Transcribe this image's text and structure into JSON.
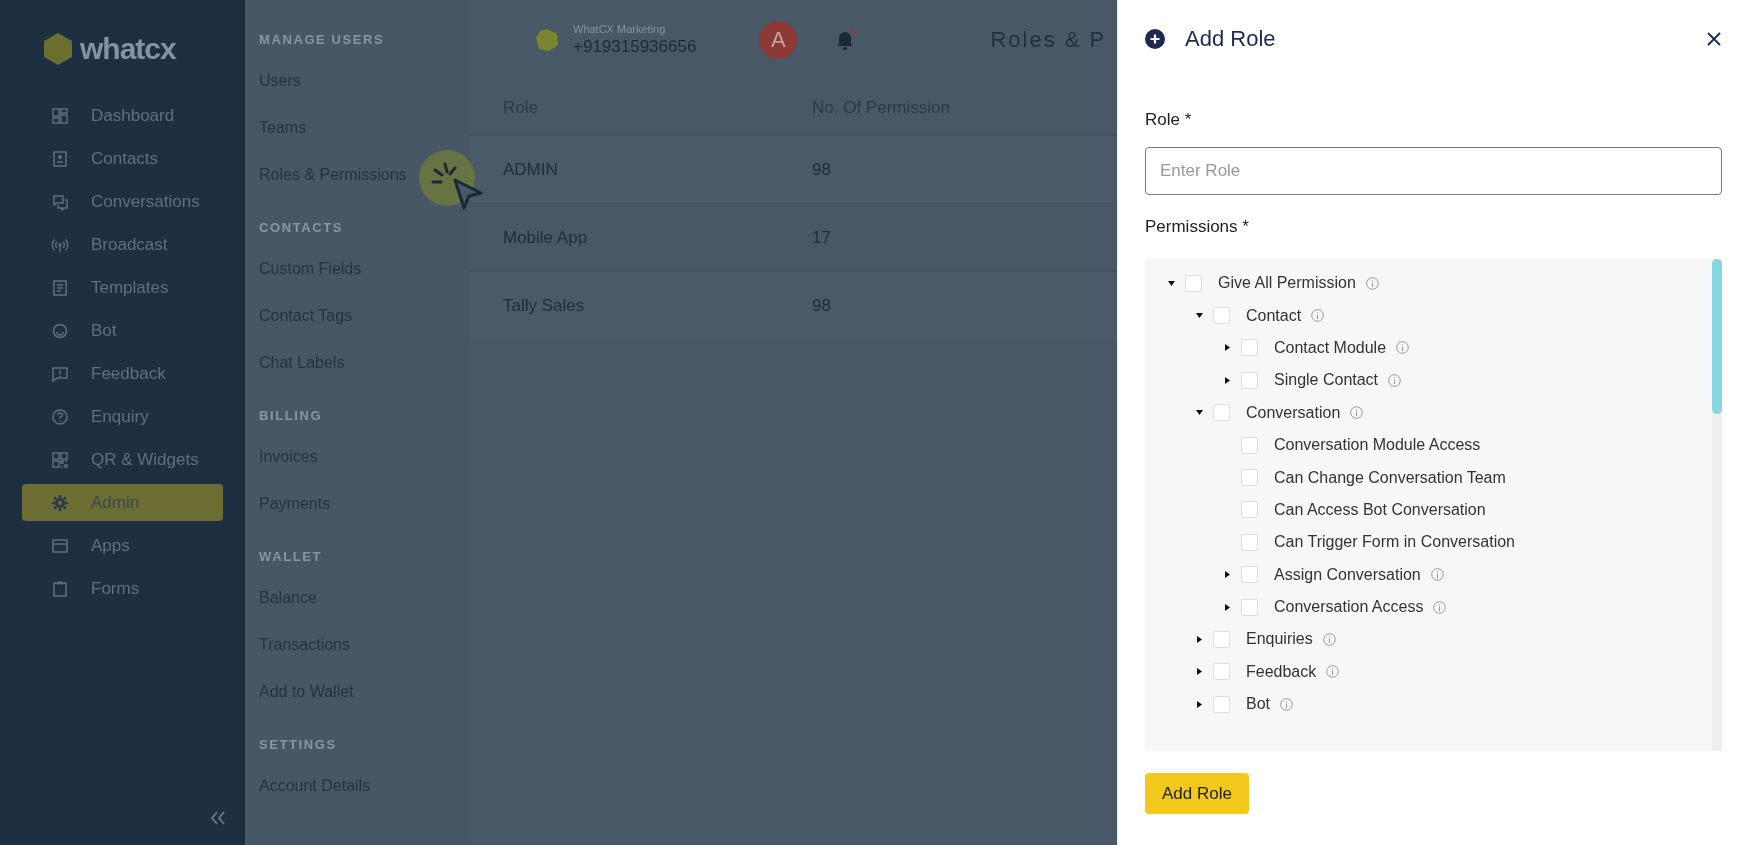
{
  "sidebar": {
    "logo": "whatcx",
    "items": [
      {
        "label": "Dashboard",
        "selected": false
      },
      {
        "label": "Contacts",
        "selected": false
      },
      {
        "label": "Conversations",
        "selected": false
      },
      {
        "label": "Broadcast",
        "selected": false
      },
      {
        "label": "Templates",
        "selected": false
      },
      {
        "label": "Bot",
        "selected": false
      },
      {
        "label": "Feedback",
        "selected": false
      },
      {
        "label": "Enquiry",
        "selected": false
      },
      {
        "label": "QR & Widgets",
        "selected": false
      },
      {
        "label": "Admin",
        "selected": true
      },
      {
        "label": "Apps",
        "selected": false
      },
      {
        "label": "Forms",
        "selected": false
      }
    ]
  },
  "subnav": {
    "sections": [
      {
        "heading": "MANAGE USERS",
        "items": [
          "Users",
          "Teams",
          "Roles & Permissions"
        ]
      },
      {
        "heading": "CONTACTS",
        "items": [
          "Custom Fields",
          "Contact Tags",
          "Chat Labels"
        ]
      },
      {
        "heading": "BILLING",
        "items": [
          "Invoices",
          "Payments"
        ]
      },
      {
        "heading": "WALLET",
        "items": [
          "Balance",
          "Transactions",
          "Add to Wallet"
        ]
      },
      {
        "heading": "SETTINGS",
        "items": [
          "Account Details"
        ]
      }
    ]
  },
  "header": {
    "account_name": "WhatCX Marketing",
    "phone": "+919315936656",
    "avatar": "A",
    "page_title": "Roles & P"
  },
  "table": {
    "columns": [
      "Role",
      "No. Of Permission"
    ],
    "rows": [
      [
        "ADMIN",
        "98"
      ],
      [
        "Mobile App",
        "17"
      ],
      [
        "Tally Sales",
        "98"
      ]
    ]
  },
  "drawer": {
    "title": "Add Role",
    "role_label": "Role *",
    "role_field": {
      "placeholder": "Enter Role"
    },
    "permissions_label": "Permissions *",
    "tree": [
      {
        "label": "Give All Permission",
        "kind": "branch",
        "expanded": true,
        "checked": false,
        "info": true,
        "children": [
          {
            "label": "Contact",
            "kind": "branch",
            "expanded": true,
            "checked": false,
            "info": true,
            "children": [
              {
                "label": "Contact Module",
                "kind": "branch",
                "expanded": false,
                "checked": false,
                "info": true
              },
              {
                "label": "Single Contact",
                "kind": "branch",
                "expanded": false,
                "checked": false,
                "info": true
              }
            ]
          },
          {
            "label": "Conversation",
            "kind": "branch",
            "expanded": true,
            "checked": false,
            "info": true,
            "children": [
              {
                "label": "Conversation Module Access",
                "kind": "leaf",
                "checked": false,
                "info": false
              },
              {
                "label": "Can Change Conversation Team",
                "kind": "leaf",
                "checked": false,
                "info": false
              },
              {
                "label": "Can Access Bot Conversation",
                "kind": "leaf",
                "checked": false,
                "info": false
              },
              {
                "label": "Can Trigger Form in Conversation",
                "kind": "leaf",
                "checked": false,
                "info": false
              },
              {
                "label": "Assign Conversation",
                "kind": "branch",
                "expanded": false,
                "checked": false,
                "info": true
              },
              {
                "label": "Conversation Access",
                "kind": "branch",
                "expanded": false,
                "checked": false,
                "info": true
              }
            ]
          },
          {
            "label": "Enquiries",
            "kind": "branch",
            "expanded": false,
            "checked": false,
            "info": true
          },
          {
            "label": "Feedback",
            "kind": "branch",
            "expanded": false,
            "checked": false,
            "info": true
          },
          {
            "label": "Bot",
            "kind": "branch",
            "expanded": false,
            "checked": false,
            "info": true
          }
        ]
      }
    ],
    "submit": "Add Role"
  }
}
